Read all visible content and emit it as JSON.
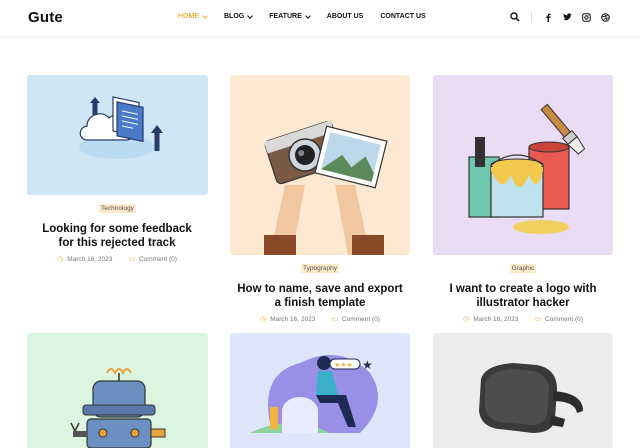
{
  "site": {
    "logo": "Gute"
  },
  "nav": [
    {
      "label": "HOME",
      "dropdown": true,
      "active": true
    },
    {
      "label": "BLOG",
      "dropdown": true,
      "active": false
    },
    {
      "label": "FEATURE",
      "dropdown": true,
      "active": false
    },
    {
      "label": "ABOUT US",
      "dropdown": false,
      "active": false
    },
    {
      "label": "CONTACT US",
      "dropdown": false,
      "active": false
    }
  ],
  "header_icons": [
    "search-icon",
    "facebook-icon",
    "twitter-icon",
    "instagram-icon",
    "dribbble-icon"
  ],
  "colors": {
    "accent": "#f3b33c",
    "tag_bg": "#fdebc9"
  },
  "posts": [
    {
      "category": "Technology",
      "title_line1": "Looking for some feedback",
      "title_line2": "for this rejected track",
      "date": "March 16, 2023",
      "comments": "Comment (0)",
      "bg": "#cfe6f5"
    },
    {
      "category": "Typography",
      "title_line1": "How to name, save and export",
      "title_line2": "a finish template",
      "date": "March 16, 2023",
      "comments": "Comment (0)",
      "bg": "#fde9d2"
    },
    {
      "category": "Graphic",
      "title_line1": "I want to create a logo with",
      "title_line2": "illustrator hacker",
      "date": "March 16, 2023",
      "comments": "Comment (0)",
      "bg": "#ebdcf5"
    },
    {
      "bg": "#dcf5df"
    },
    {
      "bg": "#dee6fb"
    },
    {
      "bg": "#ececec"
    }
  ]
}
